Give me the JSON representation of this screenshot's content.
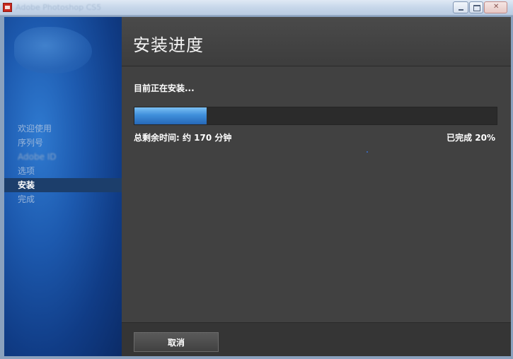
{
  "window": {
    "title": "Adobe Photoshop CS5"
  },
  "sidebar": {
    "items": [
      {
        "label": "欢迎使用",
        "state": "done"
      },
      {
        "label": "序列号",
        "state": "done"
      },
      {
        "label": "Adobe ID",
        "state": "faint"
      },
      {
        "label": "选项",
        "state": "done"
      },
      {
        "label": "安装",
        "state": "active"
      },
      {
        "label": "完成",
        "state": "pending"
      }
    ]
  },
  "main": {
    "title": "安装进度",
    "status": "目前正在安装...",
    "progress_fraction": 0.2,
    "remaining": "总剩余时间: 约 170 分钟",
    "completed": "已完成 20%"
  },
  "footer": {
    "cancel_label": "取消"
  },
  "colors": {
    "progress_fill": "#3f8fdb",
    "sidebar_bg": "#1d5aaf",
    "main_bg": "#414141",
    "active_item_bg": "#1c3e6b"
  }
}
